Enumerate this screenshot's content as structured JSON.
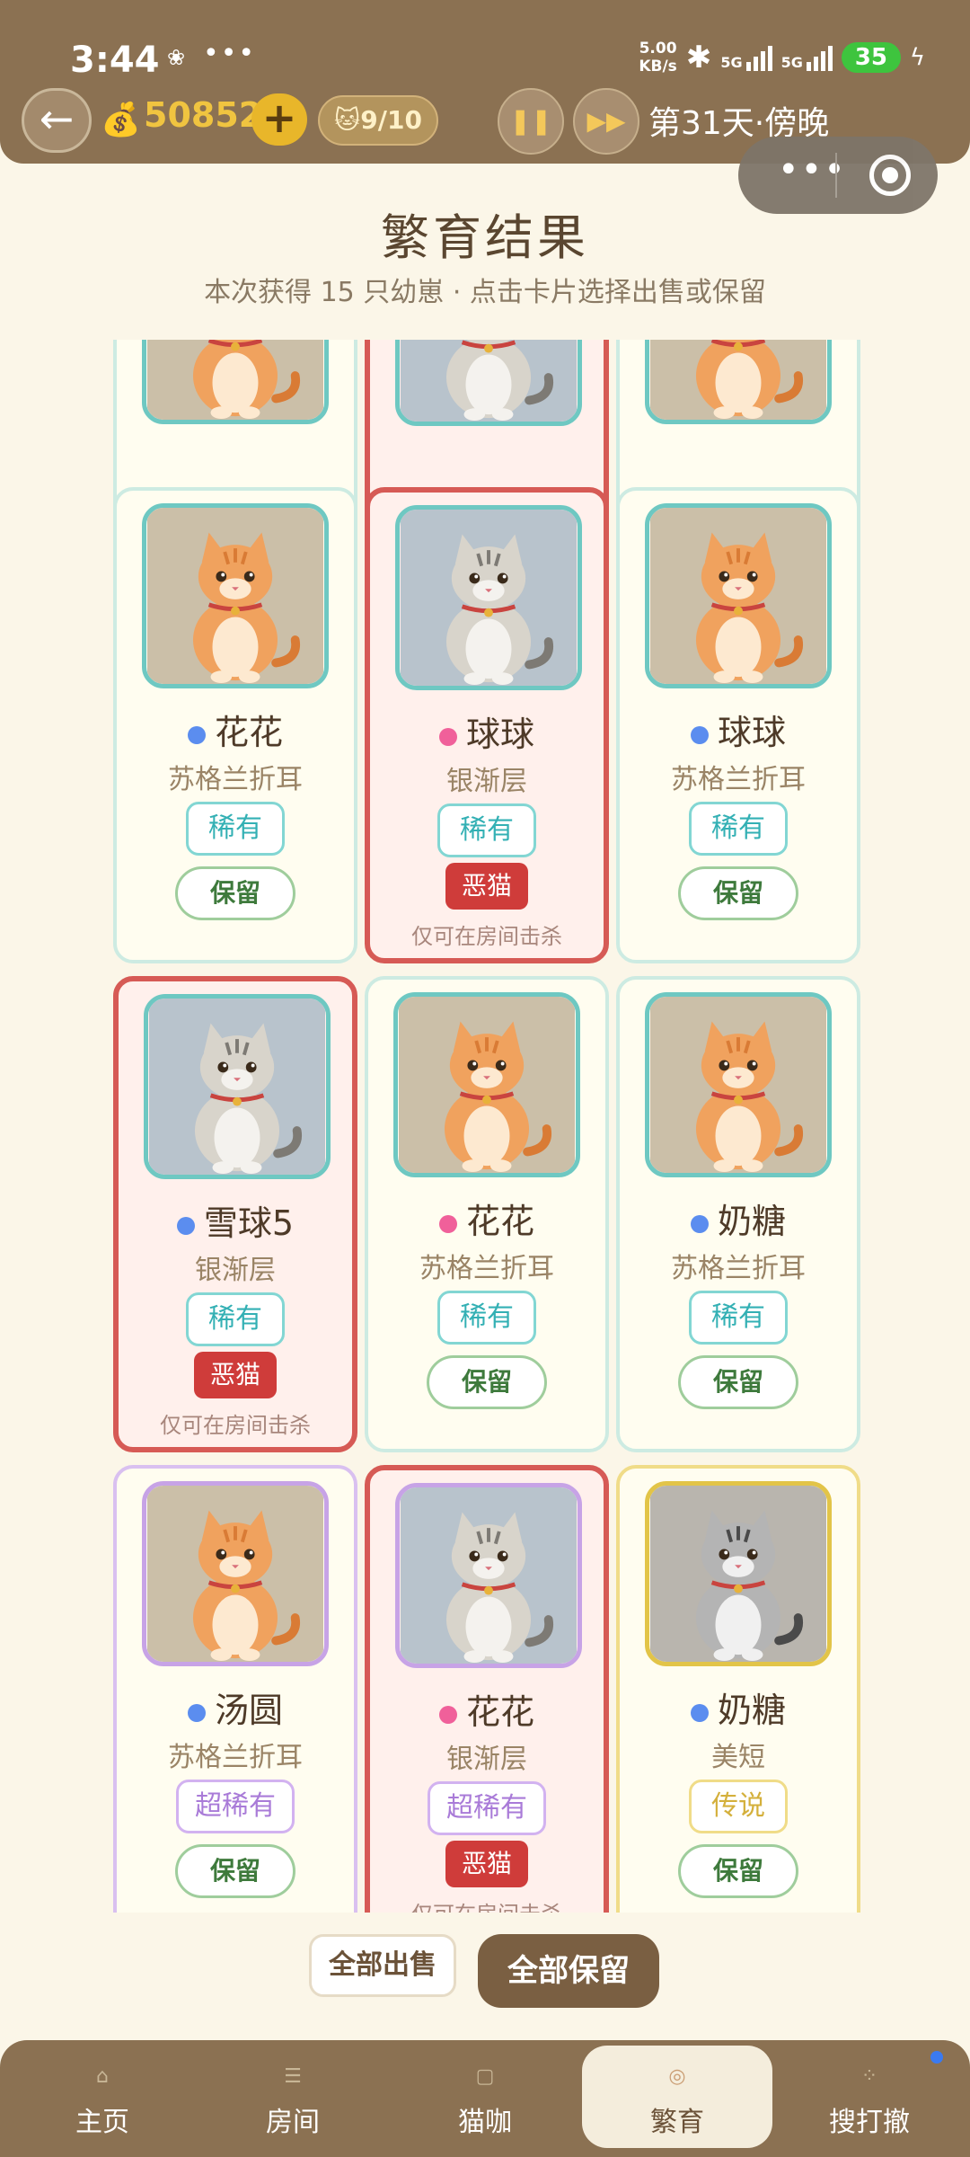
{
  "status_bar": {
    "time": "3:44",
    "speed_value": "5.00",
    "speed_unit": "KB/s",
    "network_1": "5G",
    "network_2": "5G",
    "battery": "35"
  },
  "game_bar": {
    "coins": "50852",
    "cat_count": "9/10",
    "day_text": "第31天·傍晚",
    "back_icon": "arrow-left-icon",
    "coin_icon": "money-bag-icon"
  },
  "header": {
    "title": "繁育结果",
    "subtitle": "本次获得 15 只幼崽 · 点击卡片选择出售或保留"
  },
  "labels": {
    "keep": "保留",
    "evil": "恶猫",
    "evil_note": "仅可在房间击杀"
  },
  "colors": {
    "male_dot": "#5b8def",
    "female_dot": "#f0609a",
    "evil_border": "#d65a55",
    "evil_badge": "#cf3c3a"
  },
  "kittens": [
    {
      "name": "",
      "breed": "",
      "rarity": "",
      "gender": "",
      "evil": false,
      "fur": "orange"
    },
    {
      "name": "",
      "breed": "",
      "rarity": "",
      "gender": "",
      "evil": true,
      "fur": "silver"
    },
    {
      "name": "",
      "breed": "",
      "rarity": "",
      "gender": "",
      "evil": false,
      "fur": "orange"
    },
    {
      "name": "花花",
      "breed": "苏格兰折耳",
      "rarity": "稀有",
      "gender": "male",
      "evil": false,
      "fur": "orange"
    },
    {
      "name": "球球",
      "breed": "银渐层",
      "rarity": "稀有",
      "gender": "female",
      "evil": true,
      "fur": "silver"
    },
    {
      "name": "球球",
      "breed": "苏格兰折耳",
      "rarity": "稀有",
      "gender": "male",
      "evil": false,
      "fur": "orange"
    },
    {
      "name": "雪球5",
      "breed": "银渐层",
      "rarity": "稀有",
      "gender": "male",
      "evil": true,
      "fur": "silver"
    },
    {
      "name": "花花",
      "breed": "苏格兰折耳",
      "rarity": "稀有",
      "gender": "female",
      "evil": false,
      "fur": "orange"
    },
    {
      "name": "奶糖",
      "breed": "苏格兰折耳",
      "rarity": "稀有",
      "gender": "male",
      "evil": false,
      "fur": "orange"
    },
    {
      "name": "汤圆",
      "breed": "苏格兰折耳",
      "rarity": "超稀有",
      "gender": "male",
      "evil": false,
      "fur": "orange"
    },
    {
      "name": "花花",
      "breed": "银渐层",
      "rarity": "超稀有",
      "gender": "female",
      "evil": true,
      "fur": "silver"
    },
    {
      "name": "奶糖",
      "breed": "美短",
      "rarity": "传说",
      "gender": "male",
      "evil": false,
      "fur": "tabby"
    }
  ],
  "actions": {
    "sell_all": "全部出售",
    "keep_all": "全部保留"
  },
  "nav": [
    {
      "label": "主页",
      "icon": "home-icon"
    },
    {
      "label": "房间",
      "icon": "room-icon"
    },
    {
      "label": "猫咖",
      "icon": "cafe-icon"
    },
    {
      "label": "繁育",
      "icon": "breed-icon"
    },
    {
      "label": "搜打撤",
      "icon": "search-fight-icon"
    }
  ]
}
